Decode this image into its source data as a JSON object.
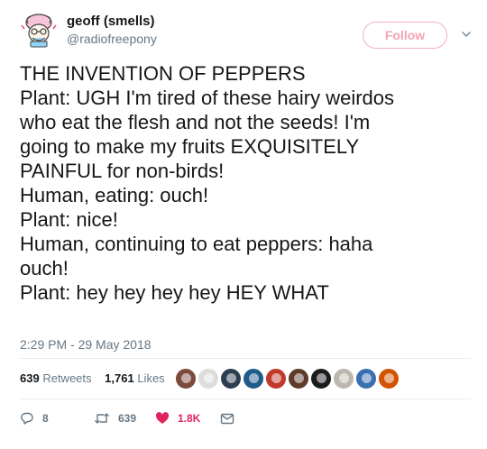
{
  "author": {
    "name": "geoff (smells)",
    "handle": "@radiofreepony"
  },
  "follow_label": "Follow",
  "tweet_lines": [
    "THE INVENTION OF PEPPERS",
    "Plant: UGH I'm tired of these hairy weirdos",
    "who eat the flesh and not the seeds! I'm",
    "going to make my fruits EXQUISITELY",
    "PAINFUL for non-birds!",
    "Human, eating: ouch!",
    "Plant: nice!",
    "Human, continuing to eat peppers: haha",
    "ouch!",
    "Plant: hey hey hey hey HEY WHAT"
  ],
  "timestamp": "2:29 PM - 29 May 2018",
  "stats": {
    "retweets_count": "639",
    "retweets_label": "Retweets",
    "likes_count": "1,761",
    "likes_label": "Likes"
  },
  "liker_avatar_colors": [
    "#7a4a3a",
    "#dcdcdc",
    "#2c3e50",
    "#1e5a8a",
    "#c0392b",
    "#5d3a2a",
    "#1c1c1c",
    "#bdb8ad",
    "#3a6fb0",
    "#d35400"
  ],
  "actions": {
    "reply_count": "8",
    "retweet_count": "639",
    "like_count": "1.8K"
  },
  "colors": {
    "text": "#14171a",
    "muted": "#657786",
    "follow_accent": "#f4a3b5",
    "like_red": "#e0245e",
    "divider": "#e6ecf0"
  },
  "icons": {
    "caret": "chevron-down-icon",
    "reply": "reply-icon",
    "retweet": "retweet-icon",
    "like": "heart-icon",
    "dm": "envelope-icon"
  }
}
